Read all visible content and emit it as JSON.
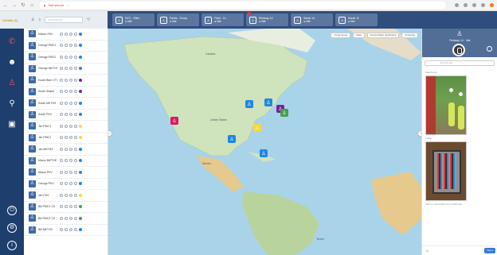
{
  "browser": {
    "security_label": "Not secure",
    "url": "...",
    "icons": [
      "back-icon",
      "forward-icon",
      "reload-icon",
      "home-icon"
    ]
  },
  "app": {
    "logo_text": "Unitalk (1)",
    "search_placeholder": "Search/Select"
  },
  "channels": [
    {
      "title": "NYC - Ellen",
      "sub": "● Idle",
      "badge": false
    },
    {
      "title": "Fields - Group",
      "sub": "● Idle",
      "badge": false
    },
    {
      "title": "Field - 14",
      "sub": "● Idle",
      "badge": false
    },
    {
      "title": "Redway 14",
      "sub": "● Idle",
      "badge": true
    },
    {
      "title": "Sarah 14",
      "sub": "● Idle",
      "badge": false
    },
    {
      "title": "Sarah 11",
      "sub": "● Idle",
      "badge": false
    }
  ],
  "contacts": [
    {
      "name": "Mason PKV",
      "status": "#1e88e5"
    },
    {
      "name": "George PMC1",
      "status": "#1e88e5"
    },
    {
      "name": "George PMC2",
      "status": "#1e88e5"
    },
    {
      "name": "George MKTHS",
      "status": "#1e88e5"
    },
    {
      "name": "South Blue CTG",
      "status": "#7b1fa2"
    },
    {
      "name": "South Sharin",
      "status": "#7b1fa2"
    },
    {
      "name": "South MKTHS",
      "status": "#1e88e5"
    },
    {
      "name": "South PKV",
      "status": "#1e88e5"
    },
    {
      "name": "Jim PMC1",
      "status": "#fdd835"
    },
    {
      "name": "Jim PMC2",
      "status": "#fdd835"
    },
    {
      "name": "Jim MKTHS",
      "status": "#1e88e5"
    },
    {
      "name": "Marco MKTHS",
      "status": "#1e88e5"
    },
    {
      "name": "Marco PKV",
      "status": "#1e88e5"
    },
    {
      "name": "George PKV",
      "status": "#1e88e5"
    },
    {
      "name": "Jim PKV",
      "status": "#fdd835"
    },
    {
      "name": "Bill PMC1 CS",
      "status": "#43a047"
    },
    {
      "name": "Bill PMC2 CS",
      "status": "#43a047"
    },
    {
      "name": "Bill MKTHS",
      "status": "#1e88e5"
    }
  ],
  "map": {
    "toolbar": [
      "Cloud Group",
      "Data",
      "Device/Static distributing",
      "Schedule"
    ],
    "labels": [
      "Canada",
      "United States",
      "Mexico",
      "Brazil"
    ]
  },
  "right_panel": {
    "user_name": "Redway 14",
    "user_status": "Idle",
    "search_placeholder": "Search/User",
    "photo1_label": "Attachment",
    "photo2_label": "Image",
    "footer_text": "This is a description from CEO site",
    "send_label": "Send"
  }
}
